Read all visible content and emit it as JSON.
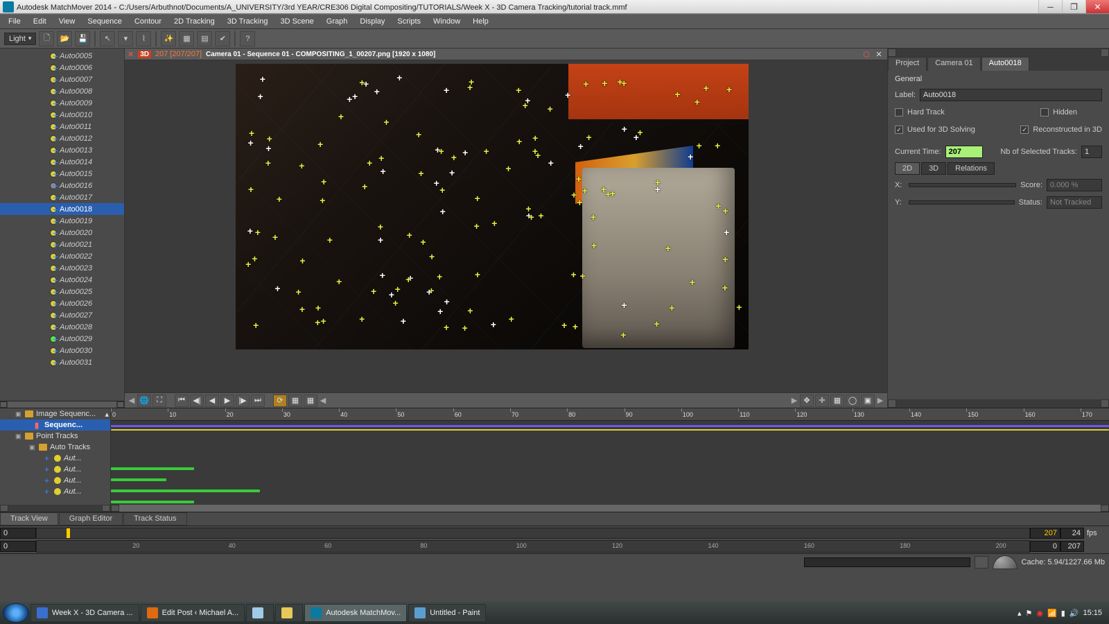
{
  "titlebar": {
    "app": "Autodesk MatchMover 2014",
    "path": "C:/Users/Arbuthnot/Documents/A_UNIVERSITY/3rd YEAR/CRE306 Digital Compositing/TUTORIALS/Week X - 3D Camera Tracking/tutorial track.mmf"
  },
  "menu": [
    "File",
    "Edit",
    "View",
    "Sequence",
    "Contour",
    "2D Tracking",
    "3D Tracking",
    "3D Scene",
    "Graph",
    "Display",
    "Scripts",
    "Window",
    "Help"
  ],
  "toolbar": {
    "light": "Light"
  },
  "tree": {
    "items": [
      {
        "name": "Auto0005",
        "dot": "yellow"
      },
      {
        "name": "Auto0006",
        "dot": "yellow"
      },
      {
        "name": "Auto0007",
        "dot": "yellow"
      },
      {
        "name": "Auto0008",
        "dot": "yellow"
      },
      {
        "name": "Auto0009",
        "dot": "yellow"
      },
      {
        "name": "Auto0010",
        "dot": "yellow"
      },
      {
        "name": "Auto0011",
        "dot": "yellow"
      },
      {
        "name": "Auto0012",
        "dot": "yellow"
      },
      {
        "name": "Auto0013",
        "dot": "yellow"
      },
      {
        "name": "Auto0014",
        "dot": "yellow"
      },
      {
        "name": "Auto0015",
        "dot": "yellow"
      },
      {
        "name": "Auto0016",
        "dot": "gray"
      },
      {
        "name": "Auto0017",
        "dot": "yellow"
      },
      {
        "name": "Auto0018",
        "dot": "yellow",
        "sel": true
      },
      {
        "name": "Auto0019",
        "dot": "yellow"
      },
      {
        "name": "Auto0020",
        "dot": "yellow"
      },
      {
        "name": "Auto0021",
        "dot": "yellow"
      },
      {
        "name": "Auto0022",
        "dot": "yellow"
      },
      {
        "name": "Auto0023",
        "dot": "yellow"
      },
      {
        "name": "Auto0024",
        "dot": "yellow"
      },
      {
        "name": "Auto0025",
        "dot": "yellow"
      },
      {
        "name": "Auto0026",
        "dot": "yellow"
      },
      {
        "name": "Auto0027",
        "dot": "yellow"
      },
      {
        "name": "Auto0028",
        "dot": "yellow"
      },
      {
        "name": "Auto0029",
        "dot": "green"
      },
      {
        "name": "Auto0030",
        "dot": "yellow"
      },
      {
        "name": "Auto0031",
        "dot": "yellow"
      }
    ]
  },
  "viewport": {
    "frame": "207",
    "range": "[207/207]",
    "seq": "Camera 01 - Sequence 01 - COMPOSITING_1_00207.png [1920 x 1080]"
  },
  "props": {
    "tabs": [
      "Project",
      "Camera 01",
      "Auto0018"
    ],
    "active_tab": 2,
    "section": "General",
    "label_lbl": "Label:",
    "label_val": "Auto0018",
    "hardtrack_lbl": "Hard Track",
    "hidden_lbl": "Hidden",
    "used3d_lbl": "Used for 3D Solving",
    "recon_lbl": "Reconstructed in 3D",
    "curtime_lbl": "Current Time:",
    "curtime_val": "207",
    "nbsel_lbl": "Nb of Selected Tracks:",
    "nbsel_val": "1",
    "subtabs": [
      "2D",
      "3D",
      "Relations"
    ],
    "x_lbl": "X:",
    "y_lbl": "Y:",
    "score_lbl": "Score:",
    "score_val": "0.000 %",
    "status_lbl": "Status:",
    "status_val": "Not Tracked"
  },
  "tl": {
    "imgsq": "Image Sequenc...",
    "seq": "Sequenc...",
    "pts": "Point Tracks",
    "autos": "Auto Tracks",
    "aut": "Aut...",
    "ruler": [
      0,
      10,
      20,
      30,
      40,
      50,
      60,
      70,
      80,
      90,
      100,
      110,
      120,
      130,
      140,
      150,
      160,
      170
    ],
    "bottabs": [
      "Track View",
      "Graph Editor",
      "Track Status"
    ]
  },
  "range": {
    "start": "0",
    "end": "207",
    "fps_lbl": "fps",
    "fps": "24",
    "cur": "207",
    "ruler": [
      20,
      40,
      60,
      80,
      100,
      120,
      140,
      160,
      180,
      200
    ]
  },
  "status": {
    "cache": "Cache: 5.94/1227.66 Mb"
  },
  "taskbar": {
    "items": [
      {
        "label": "Week X - 3D Camera ...",
        "color": "#3a6fd0"
      },
      {
        "label": "Edit Post ‹ Michael A...",
        "color": "#e06a10"
      },
      {
        "label": "",
        "color": "#a0cae8",
        "narrow": true
      },
      {
        "label": "",
        "color": "#e8c858",
        "narrow": true
      },
      {
        "label": "Autodesk MatchMov...",
        "color": "#0a7aa0",
        "active": true
      },
      {
        "label": "Untitled - Paint",
        "color": "#5a9ed0"
      }
    ],
    "clock": "15:15"
  }
}
